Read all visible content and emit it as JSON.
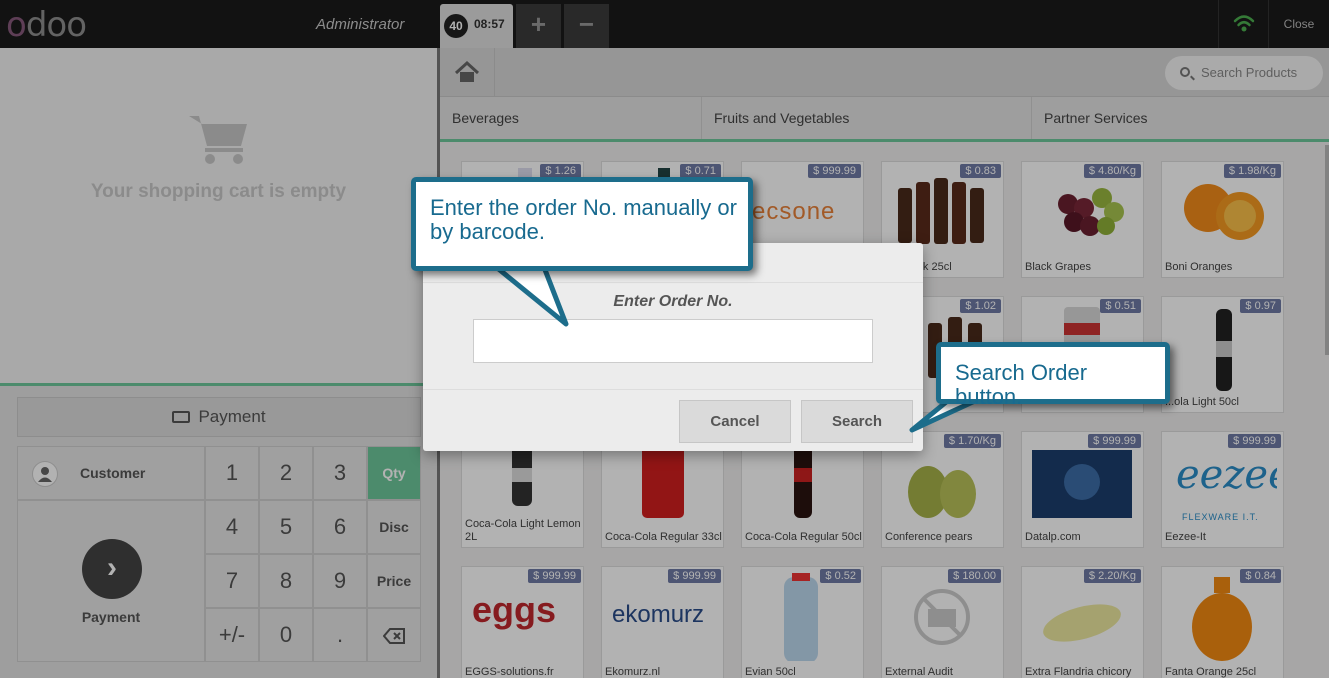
{
  "header": {
    "logo": "odoo",
    "user": "Administrator",
    "order_tab": {
      "number": "40",
      "time": "08:57"
    },
    "add_order_label": "+",
    "remove_order_label": "−",
    "close_label": "Close"
  },
  "cart": {
    "empty_message": "Your shopping cart is empty"
  },
  "payment_bar_label": "Payment",
  "numpad": {
    "customer_label": "Customer",
    "payment_label": "Payment",
    "digits": [
      "1",
      "2",
      "3",
      "4",
      "5",
      "6",
      "7",
      "8",
      "9",
      "+/-",
      "0",
      "."
    ],
    "modes": [
      "Qty",
      "Disc",
      "Price"
    ],
    "selected_mode": "Qty"
  },
  "search": {
    "placeholder": "Search Products"
  },
  "categories": [
    "Beverages",
    "Fruits and Vegetables",
    "Partner Services"
  ],
  "products": [
    {
      "name": "",
      "price": "$ 1.26"
    },
    {
      "name": "",
      "price": "$ 0.71"
    },
    {
      "name": "",
      "price": "$ 999.99",
      "logo_text": "ecsone"
    },
    {
      "name": "...e Kriek 25cl",
      "price": "$ 0.83"
    },
    {
      "name": "Black Grapes",
      "price": "$ 4.80/Kg"
    },
    {
      "name": "Boni Oranges",
      "price": "$ 1.98/Kg"
    },
    {
      "name": "",
      "price": "$ 1.02"
    },
    {
      "name": "",
      "price": "$ 0.51"
    },
    {
      "name": "...ola Light 50cl",
      "price": "$ 0.97"
    },
    {
      "name": "Coca-Cola Light Lemon 2L",
      "price": ""
    },
    {
      "name": "Coca-Cola Regular 33cl",
      "price": ""
    },
    {
      "name": "Coca-Cola Regular 50cl",
      "price": ""
    },
    {
      "name": "Conference pears",
      "price": "$ 1.70/Kg"
    },
    {
      "name": "Datalp.com",
      "price": "$ 999.99"
    },
    {
      "name": "Eezee-It",
      "price": "$ 999.99",
      "logo_text": "FLEXWARE I.T."
    },
    {
      "name": "EGGS-solutions.fr",
      "price": "$ 999.99",
      "logo_text": "eggs"
    },
    {
      "name": "Ekomurz.nl",
      "price": "$ 999.99",
      "logo_text": "ekomurz"
    },
    {
      "name": "Evian 50cl",
      "price": "$ 0.52"
    },
    {
      "name": "External Audit",
      "price": "$ 180.00"
    },
    {
      "name": "Extra Flandria chicory",
      "price": "$ 2.20/Kg"
    },
    {
      "name": "Fanta Orange 25cl",
      "price": "$ 0.84"
    }
  ],
  "dialog": {
    "title": "Enter Order No.",
    "input_value": "",
    "cancel_label": "Cancel",
    "search_label": "Search"
  },
  "callouts": {
    "input_hint": "Enter the order No. manually or by barcode.",
    "search_hint": "Search Order button."
  },
  "colors": {
    "accent": "#6ec89b",
    "price_badge": "#6f7aa5",
    "callout": "#1d6d8b"
  }
}
